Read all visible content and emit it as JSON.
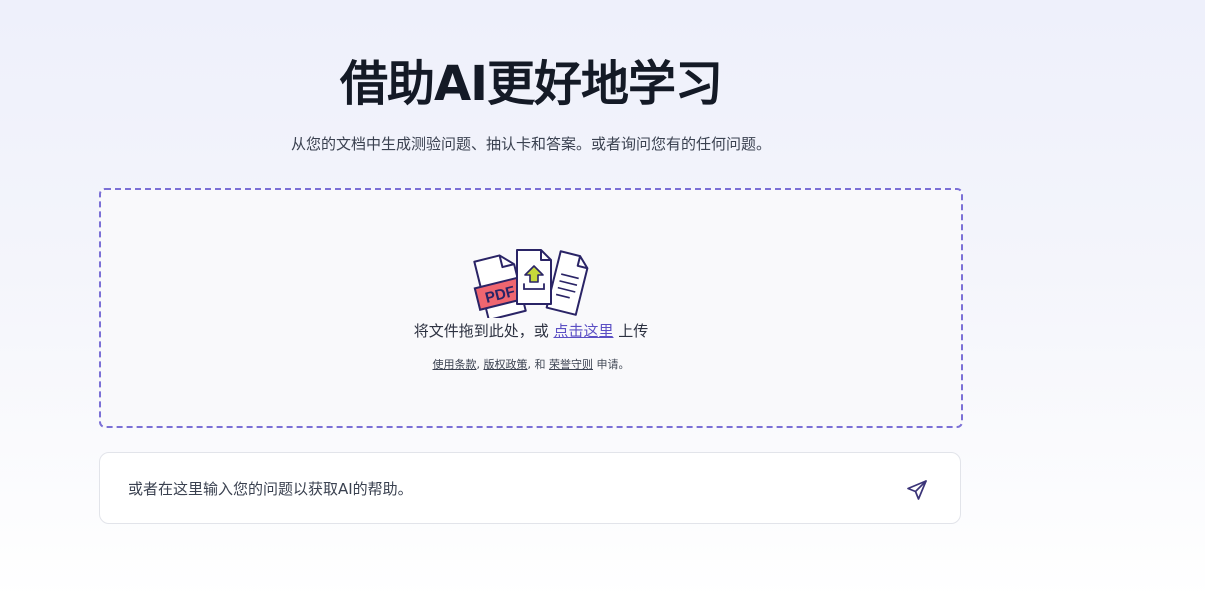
{
  "hero": {
    "title": "借助AI更好地学习",
    "subtitle": "从您的文档中生成测验问题、抽认卡和答案。或者询问您有的任何问题。"
  },
  "dropzone": {
    "illustration": {
      "icon": "documents-upload-icon",
      "pdf_label": "PDF"
    },
    "instruction_prefix": "将文件拖到此处，或",
    "instruction_link": "点击这里",
    "instruction_suffix": "上传",
    "terms": {
      "terms_of_use": "使用条款",
      "sep1": ",",
      "copyright_policy": "版权政策",
      "sep2": ", 和",
      "honor_code": "荣誉守则",
      "suffix": "申请。"
    },
    "border_color": "#7b70d6"
  },
  "ask": {
    "placeholder": "或者在这里输入您的问题以获取AI的帮助。",
    "send_icon": "send-icon"
  },
  "colors": {
    "accent": "#5b4fc4",
    "title": "#141a26"
  }
}
